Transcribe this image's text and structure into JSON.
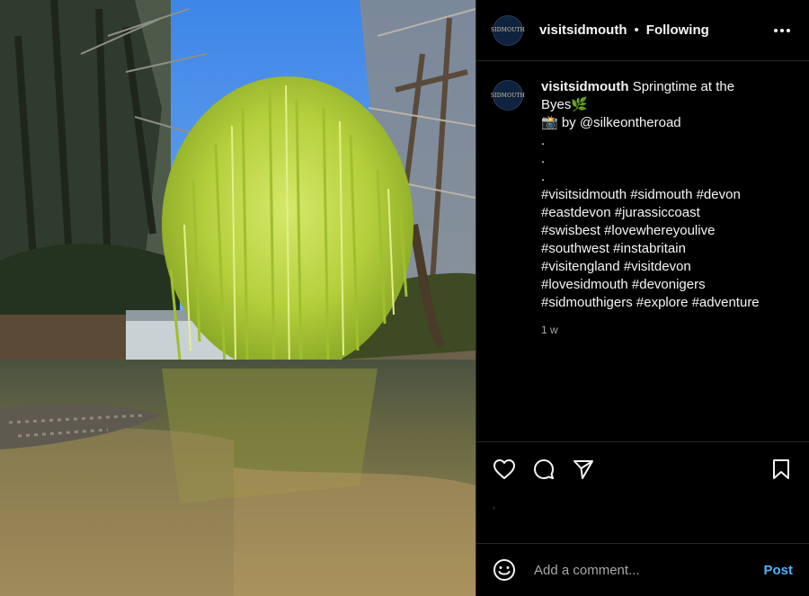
{
  "photo": {
    "alt_subject": "weeping-willow-river-photo"
  },
  "header": {
    "avatar_text": "SIDMOUTH",
    "username": "visitsidmouth",
    "separator": "•",
    "follow_label": "Following",
    "more_icon": "more-options-icon"
  },
  "caption": {
    "username": "visitsidmouth",
    "lines": [
      "Springtime at the",
      "Byes🌿",
      "📸 by @silkeontheroad",
      ".",
      ".",
      ".",
      "#visitsidmouth #sidmouth #devon",
      "#eastdevon #jurassiccoast",
      "#swisbest #lovewhereyoulive",
      "#southwest #instabritain",
      "#visitengland #visitdevon",
      "#lovesidmouth #devonigers",
      "#sidmouthigers #explore #adventure"
    ],
    "age": "1 w"
  },
  "actions": {
    "like_icon": "heart-icon",
    "comment_icon": "comment-icon",
    "share_icon": "share-icon",
    "save_icon": "bookmark-icon"
  },
  "likes_text": ",",
  "comment": {
    "emoji_icon": "smiley-icon",
    "placeholder": "Add a comment...",
    "post_label": "Post"
  },
  "colors": {
    "accent": "#4cb5f9",
    "background": "#000000",
    "divider": "#262626",
    "muted": "#a8a8a8"
  }
}
